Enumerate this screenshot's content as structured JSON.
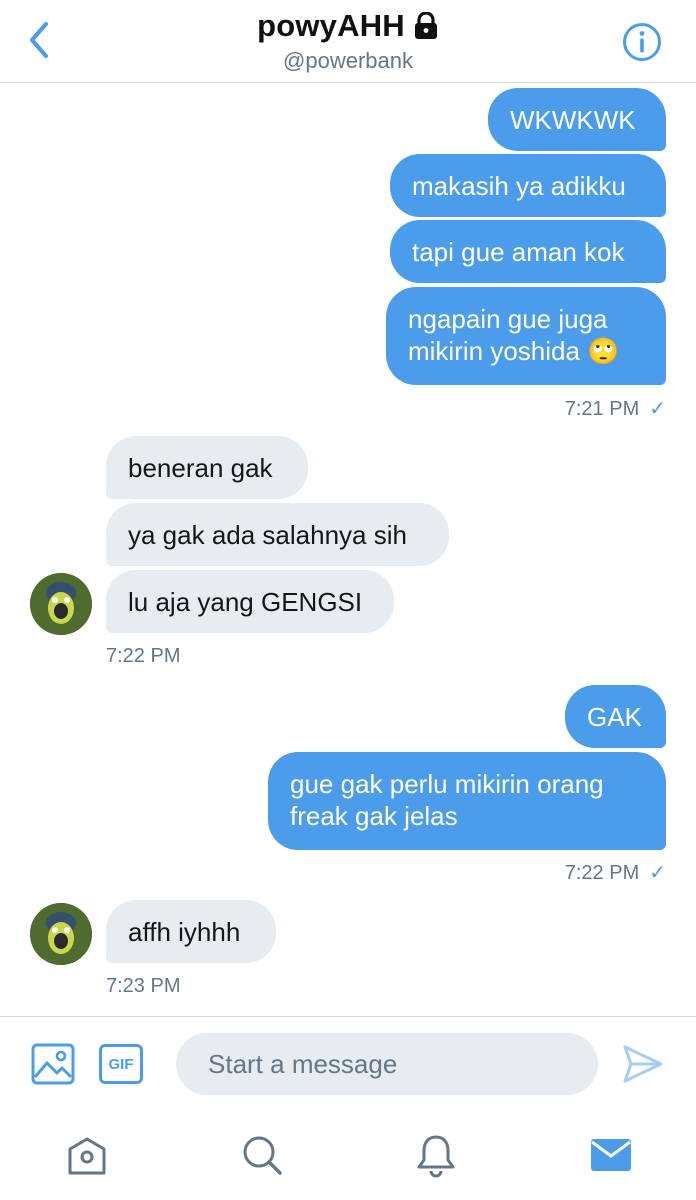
{
  "header": {
    "title": "powyAHH",
    "handle": "@powerbank"
  },
  "messages": {
    "out1": "WKWKWK",
    "out2": "makasih ya adikku",
    "out3": "tapi gue aman kok",
    "out4_line1": "ngapain gue juga",
    "out4_line2": "mikirin yoshida 🙄",
    "ts1": "7:21 PM",
    "in1": "beneran gak",
    "in2": "ya gak ada salahnya sih",
    "in3": "lu aja yang GENGSI",
    "ts2": "7:22 PM",
    "out5": "GAK",
    "out6_line1": "gue gak perlu mikirin orang",
    "out6_line2": "freak gak jelas",
    "ts3": "7:22 PM",
    "in4": "affh iyhhh",
    "ts4": "7:23 PM",
    "check": "✓"
  },
  "composer": {
    "placeholder": "Start a message",
    "gif_label": "GIF"
  },
  "colors": {
    "accent": "#4b9cea",
    "incoming_bubble": "#e6ecf0",
    "muted_text": "#657786"
  },
  "icons": {
    "back": "chevron-left-icon",
    "lock": "lock-icon",
    "info": "info-icon",
    "image": "image-icon",
    "gif": "gif-icon",
    "send": "send-icon",
    "home": "home-icon",
    "search": "search-icon",
    "notifications": "bell-icon",
    "messages": "mail-icon"
  }
}
